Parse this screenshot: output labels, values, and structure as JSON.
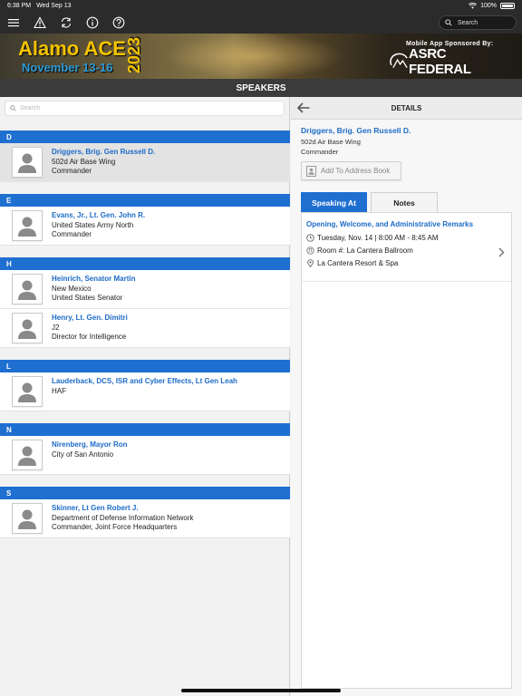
{
  "status_bar": {
    "time": "6:38 PM",
    "date": "Wed Sep 13",
    "battery": "100%"
  },
  "toolbar": {
    "search_placeholder": "Search"
  },
  "banner": {
    "title": "Alamo ACE",
    "dates": "November 13-16",
    "year": "2023",
    "sponsor_label": "Mobile App Sponsored By:",
    "sponsor_name": "ASRC FEDERAL"
  },
  "section_title": "SPEAKERS",
  "list": {
    "search_placeholder": "Search",
    "groups": [
      {
        "letter": "D",
        "speakers": [
          {
            "name": "Driggers, Brig. Gen Russell D.",
            "line1": "502d Air Base Wing",
            "line2": "Commander"
          }
        ]
      },
      {
        "letter": "E",
        "speakers": [
          {
            "name": "Evans, Jr., Lt. Gen. John R.",
            "line1": "United States Army North",
            "line2": "Commander"
          }
        ]
      },
      {
        "letter": "H",
        "speakers": [
          {
            "name": "Heinrich, Senator Martin",
            "line1": "New Mexico",
            "line2": "United States Senator"
          },
          {
            "name": "Henry, Lt. Gen. Dimitri",
            "line1": "J2",
            "line2": "Director for Intelligence"
          }
        ]
      },
      {
        "letter": "L",
        "speakers": [
          {
            "name": "Lauderback, DCS, ISR and Cyber Effects, Lt Gen Leah",
            "line1": "HAF",
            "line2": ""
          }
        ]
      },
      {
        "letter": "N",
        "speakers": [
          {
            "name": "Nirenberg, Mayor Ron",
            "line1": "City of San Antonio",
            "line2": ""
          }
        ]
      },
      {
        "letter": "S",
        "speakers": [
          {
            "name": "Skinner, Lt Gen Robert J.",
            "line1": "Department of Defense Information Network",
            "line2": "Commander, Joint Force Headquarters"
          }
        ]
      }
    ]
  },
  "details": {
    "header": "DETAILS",
    "name": "Driggers, Brig. Gen Russell D.",
    "org": "502d Air Base Wing",
    "role": "Commander",
    "add_button": "Add To Address Book",
    "tabs": [
      "Speaking At",
      "Notes"
    ],
    "session": {
      "title": "Opening, Welcome, and Administrative Remarks",
      "time": "Tuesday, Nov. 14 | 8:00 AM - 8:45 AM",
      "room": "Room #: La Cantera Ballroom",
      "location": "La Cantera Resort & Spa"
    }
  },
  "colors": {
    "accent": "#1f6fd1",
    "link": "#1d6bc7",
    "dark_bar": "#2b2b2b",
    "banner_gold": "#f4c300"
  }
}
